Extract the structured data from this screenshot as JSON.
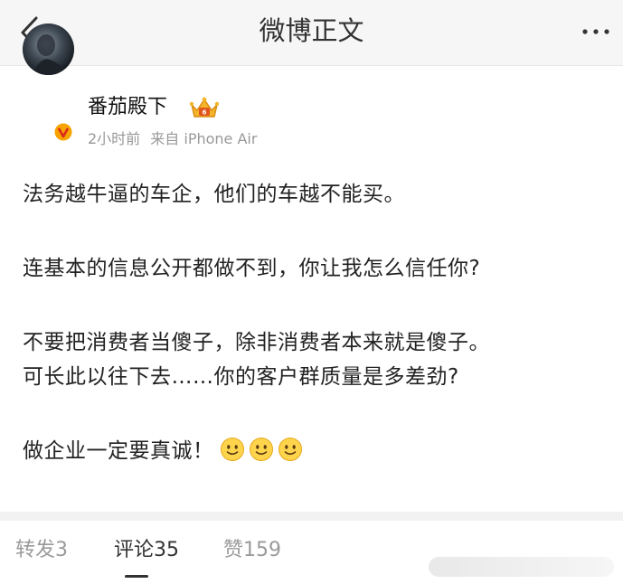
{
  "header": {
    "title": "微博正文",
    "back_icon": "chevron-left-icon",
    "more_icon": "more-horizontal-icon"
  },
  "post": {
    "author": {
      "name": "番茄殿下",
      "verified_badge_icon": "verified-v-icon",
      "level_icon": "crown-icon",
      "verified_color": "#f7a300"
    },
    "meta": {
      "time": "2小时前",
      "source": "来自 iPhone Air"
    },
    "paragraphs": [
      "法务越牛逼的车企，他们的车越不能买。",
      "连基本的信息公开都做不到，你让我怎么信任你?",
      "不要把消费者当傻子，除非消费者本来就是傻子。",
      "可长此以往下去……你的客户群质量是多差劲?",
      "做企业一定要真诚！"
    ],
    "emoji_icon": "smile-emoji-icon"
  },
  "tabs": {
    "repost": "转发3",
    "comments": "评论35",
    "likes": "赞159"
  }
}
